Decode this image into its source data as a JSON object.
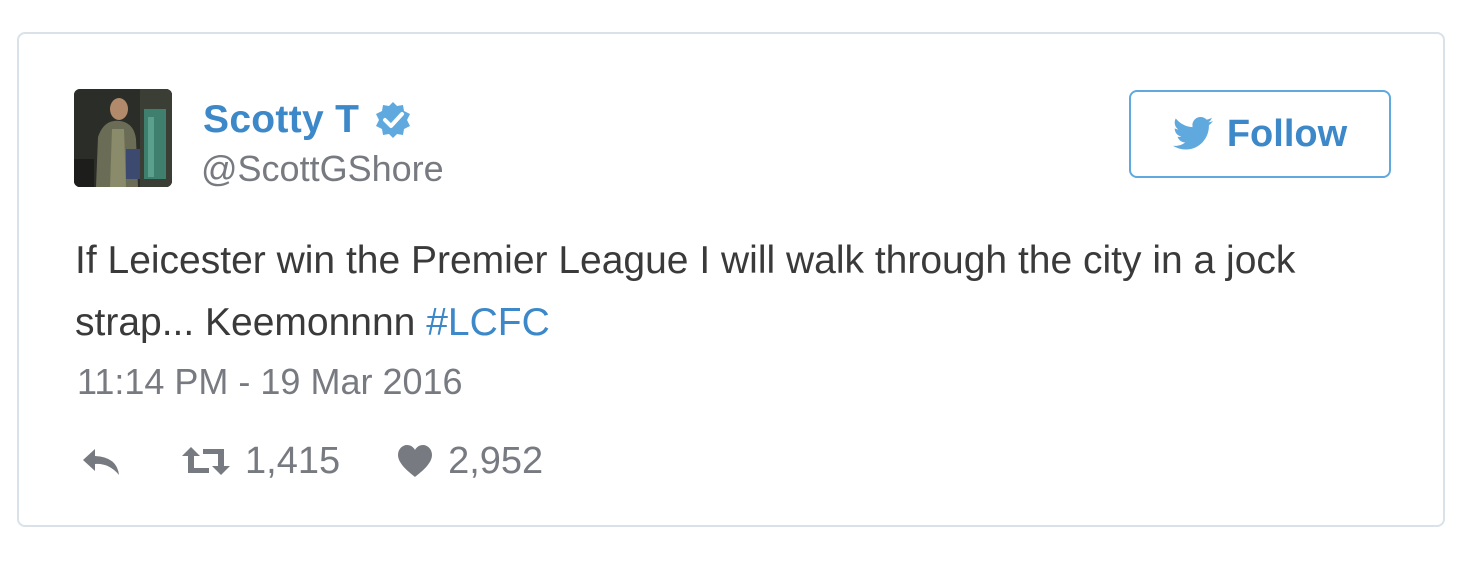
{
  "tweet": {
    "display_name": "Scotty T",
    "handle": "@ScottGShore",
    "follow_label": "Follow",
    "text_main": "If Leicester win the Premier League I will walk through the city in a jock strap... Keemonnnn ",
    "hashtag": "#LCFC",
    "timestamp": "11:14 PM - 19 Mar 2016",
    "retweet_count": "1,415",
    "like_count": "2,952"
  },
  "icons": {
    "verified": "verified-badge-icon",
    "bird": "twitter-bird-icon",
    "reply": "reply-icon",
    "retweet": "retweet-icon",
    "like": "heart-icon"
  },
  "colors": {
    "accent": "#3d88c8",
    "muted": "#777a80",
    "text": "#3a3a3a",
    "border": "#d9e2e8",
    "follow_border": "#5fa9df"
  }
}
